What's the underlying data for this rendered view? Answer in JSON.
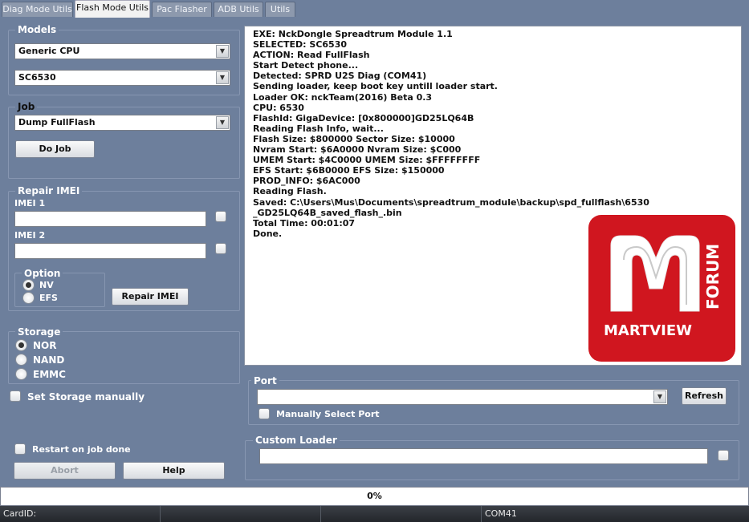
{
  "tabs": [
    {
      "label": "Diag Mode Utils",
      "active": false
    },
    {
      "label": "Flash Mode Utils",
      "active": true
    },
    {
      "label": "Pac Flasher",
      "active": false
    },
    {
      "label": "ADB Utils",
      "active": false
    },
    {
      "label": "Utils",
      "active": false
    }
  ],
  "models": {
    "label": "Models",
    "vendor": "Generic CPU",
    "model": "SC6530"
  },
  "job": {
    "label": "Job",
    "selected": "Dump FullFlash",
    "do_job": "Do Job"
  },
  "repair_imei": {
    "label": "Repair IMEI",
    "imei1_label": "IMEI 1",
    "imei1_value": "",
    "imei2_label": "IMEI 2",
    "imei2_value": "",
    "option_label": "Option",
    "options": [
      "NV",
      "EFS"
    ],
    "selected_option": "NV",
    "button": "Repair IMEI"
  },
  "storage": {
    "label": "Storage",
    "options": [
      "NOR",
      "NAND",
      "EMMC"
    ],
    "selected": "NOR",
    "manual_label": "Set Storage manually"
  },
  "restart_label": "Restart on job done",
  "abort_label": "Abort",
  "help_label": "Help",
  "log": [
    "EXE: NckDongle Spreadtrum Module 1.1",
    "SELECTED: SC6530",
    "ACTION: Read FullFlash",
    "Start Detect phone...",
    "Detected: SPRD U2S Diag (COM41)",
    "Sending loader, keep boot key untill loader start.",
    "Loader OK: nckTeam(2016) Beta 0.3",
    "CPU: 6530",
    "FlashId: GigaDevice: [0x800000]GD25LQ64B",
    "Reading Flash Info, wait...",
    "Flash Size: $800000 Sector Size: $10000",
    "Nvram Start: $6A0000 Nvram Size: $C000",
    "UMEM Start: $4C0000 UMEM Size: $FFFFFFFF",
    "EFS Start: $6B0000 EFS Size: $150000",
    "PROD_INFO: $6AC000",
    "Reading Flash.",
    "Saved: C:\\Users\\Mus\\Documents\\spreadtrum_module\\backup\\spd_fullflash\\6530",
    "_GD25LQ64B_saved_flash_.bin",
    "Total Time: 00:01:07",
    "Done."
  ],
  "logo": {
    "text": "MARTVIEW",
    "side_text": "FORUM",
    "color": "#d0161f"
  },
  "port": {
    "label": "Port",
    "selected": "",
    "refresh": "Refresh",
    "manual_label": "Manually Select Port"
  },
  "custom_loader": {
    "label": "Custom Loader",
    "value": ""
  },
  "progress": {
    "value": 0,
    "text": "0%"
  },
  "status": {
    "cardid": "CardID:",
    "port": "COM41"
  }
}
